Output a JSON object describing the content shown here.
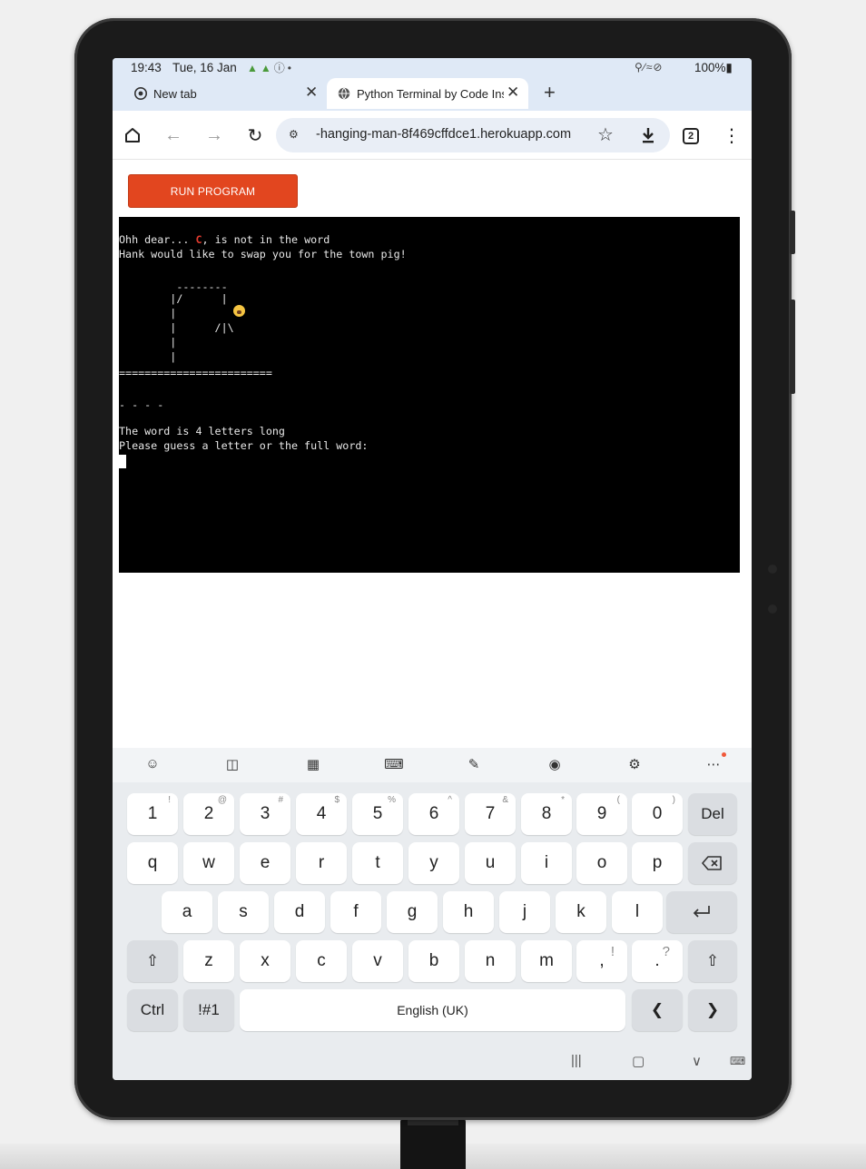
{
  "status_bar": {
    "time": "19:43",
    "date": "Tue, 16 Jan",
    "notification_icons": [
      "android-icon",
      "android-icon",
      "info-icon"
    ],
    "battery": "100%"
  },
  "tabs": [
    {
      "label": "New tab",
      "icon": "chrome-icon",
      "active": false
    },
    {
      "label": "Python Terminal by Code Ins",
      "icon": "globe-icon",
      "active": true
    }
  ],
  "toolbar": {
    "url": "-hanging-man-8f469cffdce1.herokuapp.com",
    "tab_count": "2"
  },
  "page": {
    "run_button": "RUN PROGRAM"
  },
  "terminal": {
    "line1_prefix": "Ohh dear... ",
    "line1_letter": "C",
    "line1_suffix": ", is not in the word",
    "line2": "Hank would like to swap you for the town pig!",
    "gallows": [
      "         --------",
      "        |/      |",
      "        |",
      "        |      /|\\",
      "        |",
      "        |"
    ],
    "ground": "========================",
    "blanks": "- - - -",
    "word_length": "The word is 4 letters long",
    "prompt": "Please guess a letter or the full word:"
  },
  "keyboard": {
    "number_row": [
      {
        "label": "1",
        "hint": "!"
      },
      {
        "label": "2",
        "hint": "@"
      },
      {
        "label": "3",
        "hint": "#"
      },
      {
        "label": "4",
        "hint": "$"
      },
      {
        "label": "5",
        "hint": "%"
      },
      {
        "label": "6",
        "hint": "^"
      },
      {
        "label": "7",
        "hint": "&"
      },
      {
        "label": "8",
        "hint": "*"
      },
      {
        "label": "9",
        "hint": "("
      },
      {
        "label": "0",
        "hint": ")"
      }
    ],
    "del": "Del",
    "row_q": [
      "q",
      "w",
      "e",
      "r",
      "t",
      "y",
      "u",
      "i",
      "o",
      "p"
    ],
    "row_a": [
      "a",
      "s",
      "d",
      "f",
      "g",
      "h",
      "j",
      "k",
      "l"
    ],
    "row_z": [
      "z",
      "x",
      "c",
      "v",
      "b",
      "n",
      "m"
    ],
    "comma": ",",
    "comma_hint": "!",
    "period": ".",
    "period_hint": "?",
    "ctrl": "Ctrl",
    "symbols": "!#1",
    "space": "English (UK)"
  }
}
